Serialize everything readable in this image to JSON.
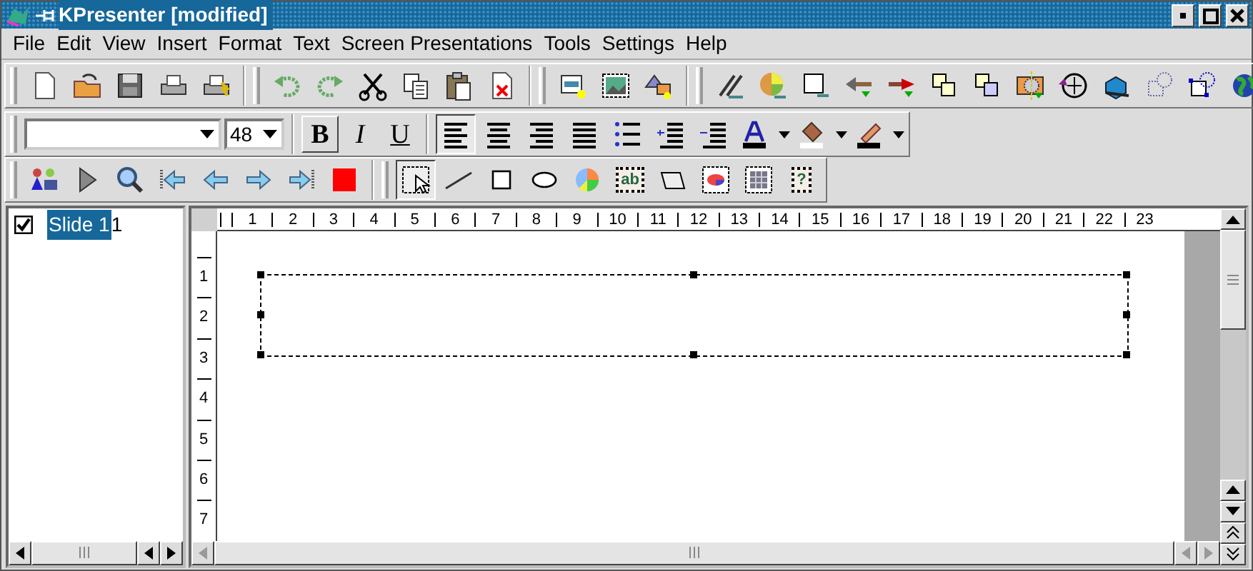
{
  "window": {
    "title": "KPresenter [modified]"
  },
  "menu": [
    "File",
    "Edit",
    "View",
    "Insert",
    "Format",
    "Text",
    "Screen Presentations",
    "Tools",
    "Settings",
    "Help"
  ],
  "format_toolbar": {
    "size": {
      "value": "48"
    },
    "style_buttons": [
      {
        "label": "B",
        "pressed": true
      },
      {
        "label": "I",
        "pressed": false
      },
      {
        "label": "U",
        "pressed": false
      }
    ],
    "align_buttons": [
      {
        "kind": "left",
        "selected": true
      },
      {
        "kind": "center",
        "selected": false
      },
      {
        "kind": "right",
        "selected": false
      },
      {
        "kind": "justify",
        "selected": false
      }
    ]
  },
  "tools": [
    {
      "kind": "select",
      "selected": true
    },
    {
      "kind": "line",
      "selected": false
    },
    {
      "kind": "rectangle",
      "selected": false
    },
    {
      "kind": "ellipse",
      "selected": false
    },
    {
      "kind": "pie",
      "selected": false
    },
    {
      "kind": "text",
      "label": "ab",
      "selected": false
    },
    {
      "kind": "polygon",
      "selected": false
    },
    {
      "kind": "chart",
      "selected": false
    },
    {
      "kind": "table",
      "selected": false
    },
    {
      "kind": "formula",
      "label": "?",
      "selected": false
    }
  ],
  "slides": [
    {
      "label": "Slide 1",
      "suffix": "1",
      "checked": true,
      "selected": true
    }
  ],
  "horizontal_ruler": [
    "1",
    "2",
    "3",
    "4",
    "5",
    "6",
    "7",
    "8",
    "9",
    "10",
    "11",
    "12",
    "13",
    "14",
    "15",
    "16",
    "17",
    "18",
    "19",
    "20",
    "21",
    "22",
    "23"
  ],
  "vertical_ruler": [
    "1",
    "2",
    "3",
    "4",
    "5",
    "6",
    "7"
  ]
}
